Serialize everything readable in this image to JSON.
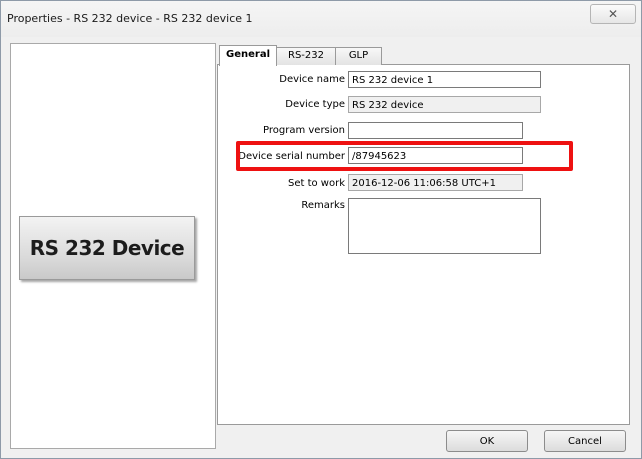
{
  "window": {
    "title": "Properties - RS 232 device - RS 232 device 1",
    "close_symbol": "✕"
  },
  "device_image": {
    "label": "RS 232 Device"
  },
  "tabs": [
    {
      "label": "General",
      "active": true
    },
    {
      "label": "RS-232",
      "active": false
    },
    {
      "label": "GLP",
      "active": false
    }
  ],
  "form": {
    "device_name": {
      "label": "Device name",
      "value": "RS 232 device 1"
    },
    "device_type": {
      "label": "Device type",
      "value": "RS 232 device"
    },
    "program_version": {
      "label": "Program version",
      "value": ""
    },
    "serial_number": {
      "label": "Device serial number",
      "value": "/87945623"
    },
    "set_to_work": {
      "label": "Set to work",
      "value": "2016-12-06 11:06:58 UTC+1"
    },
    "remarks": {
      "label": "Remarks",
      "value": ""
    }
  },
  "buttons": {
    "ok": "OK",
    "cancel": "Cancel"
  },
  "colors": {
    "highlight": "#ee1111"
  }
}
